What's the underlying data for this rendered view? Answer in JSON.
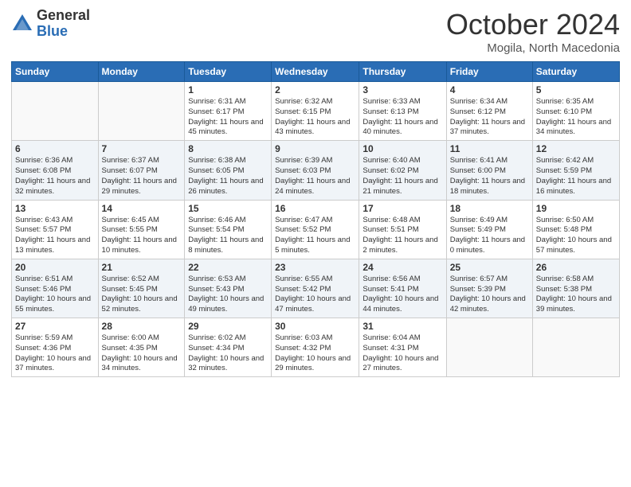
{
  "logo": {
    "general": "General",
    "blue": "Blue"
  },
  "header": {
    "month": "October 2024",
    "location": "Mogila, North Macedonia"
  },
  "weekdays": [
    "Sunday",
    "Monday",
    "Tuesday",
    "Wednesday",
    "Thursday",
    "Friday",
    "Saturday"
  ],
  "weeks": [
    [
      {
        "day": "",
        "info": ""
      },
      {
        "day": "",
        "info": ""
      },
      {
        "day": "1",
        "info": "Sunrise: 6:31 AM\nSunset: 6:17 PM\nDaylight: 11 hours and 45 minutes."
      },
      {
        "day": "2",
        "info": "Sunrise: 6:32 AM\nSunset: 6:15 PM\nDaylight: 11 hours and 43 minutes."
      },
      {
        "day": "3",
        "info": "Sunrise: 6:33 AM\nSunset: 6:13 PM\nDaylight: 11 hours and 40 minutes."
      },
      {
        "day": "4",
        "info": "Sunrise: 6:34 AM\nSunset: 6:12 PM\nDaylight: 11 hours and 37 minutes."
      },
      {
        "day": "5",
        "info": "Sunrise: 6:35 AM\nSunset: 6:10 PM\nDaylight: 11 hours and 34 minutes."
      }
    ],
    [
      {
        "day": "6",
        "info": "Sunrise: 6:36 AM\nSunset: 6:08 PM\nDaylight: 11 hours and 32 minutes."
      },
      {
        "day": "7",
        "info": "Sunrise: 6:37 AM\nSunset: 6:07 PM\nDaylight: 11 hours and 29 minutes."
      },
      {
        "day": "8",
        "info": "Sunrise: 6:38 AM\nSunset: 6:05 PM\nDaylight: 11 hours and 26 minutes."
      },
      {
        "day": "9",
        "info": "Sunrise: 6:39 AM\nSunset: 6:03 PM\nDaylight: 11 hours and 24 minutes."
      },
      {
        "day": "10",
        "info": "Sunrise: 6:40 AM\nSunset: 6:02 PM\nDaylight: 11 hours and 21 minutes."
      },
      {
        "day": "11",
        "info": "Sunrise: 6:41 AM\nSunset: 6:00 PM\nDaylight: 11 hours and 18 minutes."
      },
      {
        "day": "12",
        "info": "Sunrise: 6:42 AM\nSunset: 5:59 PM\nDaylight: 11 hours and 16 minutes."
      }
    ],
    [
      {
        "day": "13",
        "info": "Sunrise: 6:43 AM\nSunset: 5:57 PM\nDaylight: 11 hours and 13 minutes."
      },
      {
        "day": "14",
        "info": "Sunrise: 6:45 AM\nSunset: 5:55 PM\nDaylight: 11 hours and 10 minutes."
      },
      {
        "day": "15",
        "info": "Sunrise: 6:46 AM\nSunset: 5:54 PM\nDaylight: 11 hours and 8 minutes."
      },
      {
        "day": "16",
        "info": "Sunrise: 6:47 AM\nSunset: 5:52 PM\nDaylight: 11 hours and 5 minutes."
      },
      {
        "day": "17",
        "info": "Sunrise: 6:48 AM\nSunset: 5:51 PM\nDaylight: 11 hours and 2 minutes."
      },
      {
        "day": "18",
        "info": "Sunrise: 6:49 AM\nSunset: 5:49 PM\nDaylight: 11 hours and 0 minutes."
      },
      {
        "day": "19",
        "info": "Sunrise: 6:50 AM\nSunset: 5:48 PM\nDaylight: 10 hours and 57 minutes."
      }
    ],
    [
      {
        "day": "20",
        "info": "Sunrise: 6:51 AM\nSunset: 5:46 PM\nDaylight: 10 hours and 55 minutes."
      },
      {
        "day": "21",
        "info": "Sunrise: 6:52 AM\nSunset: 5:45 PM\nDaylight: 10 hours and 52 minutes."
      },
      {
        "day": "22",
        "info": "Sunrise: 6:53 AM\nSunset: 5:43 PM\nDaylight: 10 hours and 49 minutes."
      },
      {
        "day": "23",
        "info": "Sunrise: 6:55 AM\nSunset: 5:42 PM\nDaylight: 10 hours and 47 minutes."
      },
      {
        "day": "24",
        "info": "Sunrise: 6:56 AM\nSunset: 5:41 PM\nDaylight: 10 hours and 44 minutes."
      },
      {
        "day": "25",
        "info": "Sunrise: 6:57 AM\nSunset: 5:39 PM\nDaylight: 10 hours and 42 minutes."
      },
      {
        "day": "26",
        "info": "Sunrise: 6:58 AM\nSunset: 5:38 PM\nDaylight: 10 hours and 39 minutes."
      }
    ],
    [
      {
        "day": "27",
        "info": "Sunrise: 5:59 AM\nSunset: 4:36 PM\nDaylight: 10 hours and 37 minutes."
      },
      {
        "day": "28",
        "info": "Sunrise: 6:00 AM\nSunset: 4:35 PM\nDaylight: 10 hours and 34 minutes."
      },
      {
        "day": "29",
        "info": "Sunrise: 6:02 AM\nSunset: 4:34 PM\nDaylight: 10 hours and 32 minutes."
      },
      {
        "day": "30",
        "info": "Sunrise: 6:03 AM\nSunset: 4:32 PM\nDaylight: 10 hours and 29 minutes."
      },
      {
        "day": "31",
        "info": "Sunrise: 6:04 AM\nSunset: 4:31 PM\nDaylight: 10 hours and 27 minutes."
      },
      {
        "day": "",
        "info": ""
      },
      {
        "day": "",
        "info": ""
      }
    ]
  ]
}
